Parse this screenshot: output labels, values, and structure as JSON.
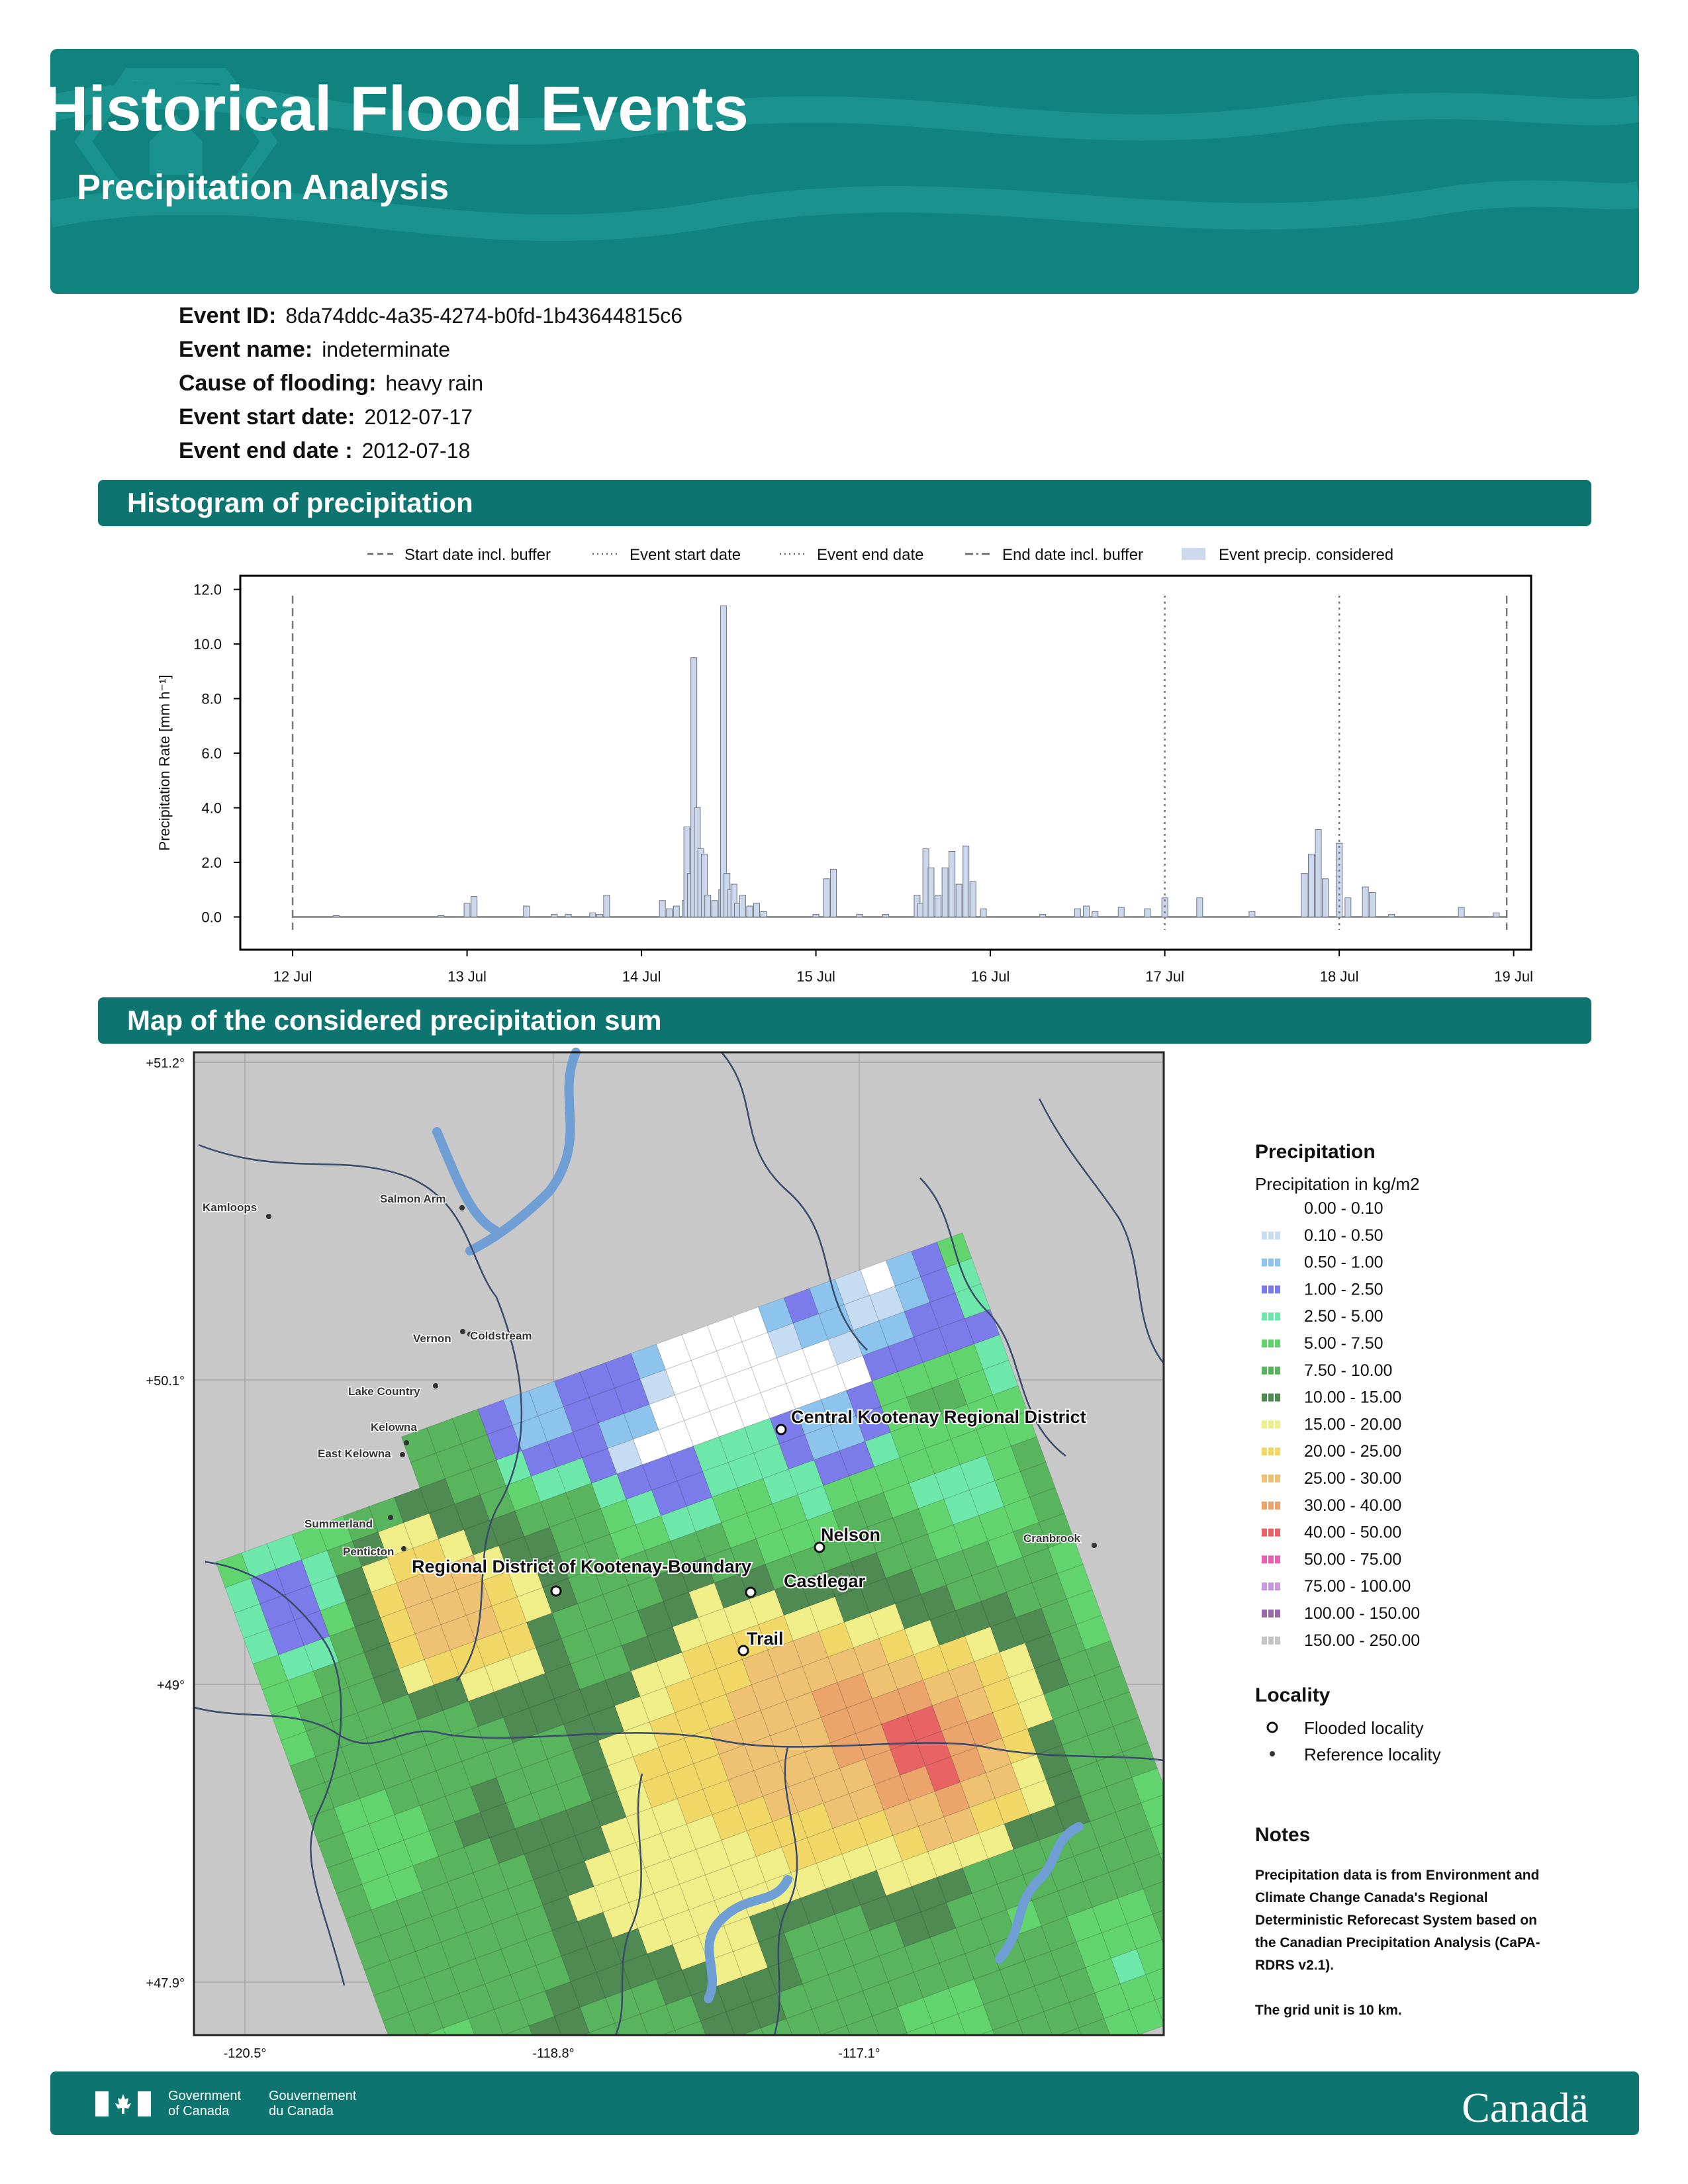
{
  "header": {
    "title": "Historical Flood Events",
    "subtitle": "Precipitation Analysis"
  },
  "event": {
    "fields": [
      {
        "label": "Event ID:",
        "value": "8da74ddc-4a35-4274-b0fd-1b43644815c6"
      },
      {
        "label": "Event name:",
        "value": "indeterminate"
      },
      {
        "label": "Cause of flooding:",
        "value": "heavy rain"
      },
      {
        "label": "Event start date:",
        "value": "2012-07-17"
      },
      {
        "label": "Event end date :",
        "value": "2012-07-18"
      }
    ]
  },
  "sections": {
    "histogram": "Histogram of precipitation",
    "map": "Map of the considered precipitation sum"
  },
  "chart_data": {
    "type": "bar",
    "ylabel": "Precipitation Rate [mm h⁻¹]",
    "ylim": [
      -1.2,
      12.5
    ],
    "yticks": [
      "0.0",
      "2.0",
      "4.0",
      "6.0",
      "8.0",
      "10.0",
      "12.0"
    ],
    "xlim": [
      11.7,
      19.1
    ],
    "xticks": [
      {
        "label": "12 Jul",
        "day": 12
      },
      {
        "label": "13 Jul",
        "day": 13
      },
      {
        "label": "14 Jul",
        "day": 14
      },
      {
        "label": "15 Jul",
        "day": 15
      },
      {
        "label": "16 Jul",
        "day": 16
      },
      {
        "label": "17 Jul",
        "day": 17
      },
      {
        "label": "18 Jul",
        "day": 18
      },
      {
        "label": "19 Jul",
        "day": 19
      }
    ],
    "legend": {
      "placement": "top",
      "entries": [
        {
          "label": "Start date incl. buffer",
          "style": "dashed"
        },
        {
          "label": "Event start date",
          "style": "dotted"
        },
        {
          "label": "Event end date",
          "style": "dotted"
        },
        {
          "label": "End date incl. buffer",
          "style": "dashdot"
        },
        {
          "label": "Event precip. considered",
          "style": "patch"
        }
      ]
    },
    "vlines": [
      {
        "day": 12.0,
        "style": "dashed"
      },
      {
        "day": 17.0,
        "style": "dotted"
      },
      {
        "day": 18.0,
        "style": "dotted"
      },
      {
        "day": 18.96,
        "style": "dashed"
      }
    ],
    "bars": [
      [
        12.25,
        0.05
      ],
      [
        12.85,
        0.05
      ],
      [
        13.0,
        0.5
      ],
      [
        13.04,
        0.75
      ],
      [
        13.34,
        0.4
      ],
      [
        13.5,
        0.1
      ],
      [
        13.58,
        0.1
      ],
      [
        13.72,
        0.15
      ],
      [
        13.76,
        0.1
      ],
      [
        13.8,
        0.8
      ],
      [
        14.12,
        0.6
      ],
      [
        14.16,
        0.3
      ],
      [
        14.2,
        0.4
      ],
      [
        14.25,
        0.6
      ],
      [
        14.26,
        3.3
      ],
      [
        14.28,
        1.6
      ],
      [
        14.3,
        9.5
      ],
      [
        14.32,
        4.0
      ],
      [
        14.34,
        2.5
      ],
      [
        14.36,
        2.3
      ],
      [
        14.38,
        0.8
      ],
      [
        14.42,
        0.6
      ],
      [
        14.46,
        1.0
      ],
      [
        14.47,
        11.4
      ],
      [
        14.49,
        1.6
      ],
      [
        14.51,
        1.0
      ],
      [
        14.53,
        1.2
      ],
      [
        14.55,
        0.5
      ],
      [
        14.58,
        0.8
      ],
      [
        14.62,
        0.4
      ],
      [
        14.66,
        0.5
      ],
      [
        14.7,
        0.2
      ],
      [
        15.0,
        0.1
      ],
      [
        15.06,
        1.4
      ],
      [
        15.1,
        1.75
      ],
      [
        15.25,
        0.1
      ],
      [
        15.4,
        0.1
      ],
      [
        15.58,
        0.8
      ],
      [
        15.6,
        0.5
      ],
      [
        15.63,
        2.5
      ],
      [
        15.66,
        1.8
      ],
      [
        15.7,
        0.8
      ],
      [
        15.74,
        1.8
      ],
      [
        15.78,
        2.4
      ],
      [
        15.82,
        1.2
      ],
      [
        15.86,
        2.6
      ],
      [
        15.9,
        1.3
      ],
      [
        15.96,
        0.3
      ],
      [
        16.3,
        0.1
      ],
      [
        16.5,
        0.3
      ],
      [
        16.55,
        0.4
      ],
      [
        16.6,
        0.2
      ],
      [
        16.75,
        0.35
      ],
      [
        16.9,
        0.3
      ],
      [
        17.0,
        0.7
      ],
      [
        17.2,
        0.7
      ],
      [
        17.5,
        0.2
      ],
      [
        17.8,
        1.6
      ],
      [
        17.84,
        2.3
      ],
      [
        17.88,
        3.2
      ],
      [
        17.92,
        1.4
      ],
      [
        18.0,
        2.7
      ],
      [
        18.05,
        0.7
      ],
      [
        18.15,
        1.1
      ],
      [
        18.19,
        0.9
      ],
      [
        18.3,
        0.1
      ],
      [
        18.7,
        0.35
      ],
      [
        18.9,
        0.15
      ]
    ]
  },
  "map": {
    "lat_labels": [
      "+51.2°",
      "+50.1°",
      "+49°",
      "+47.9°"
    ],
    "lon_labels": [
      "-120.5°",
      "-118.8°",
      "-117.1°"
    ],
    "colors": {
      "background": "#c8c8c8",
      "water": "#6e9ed4",
      "border": "#3a4a6a"
    },
    "flooded_localities": [
      {
        "name": "Central Kootenay Regional District"
      },
      {
        "name": "Nelson"
      },
      {
        "name": "Regional District of Kootenay-Boundary"
      },
      {
        "name": "Castlegar"
      },
      {
        "name": "Trail"
      }
    ],
    "reference_localities": [
      {
        "name": "Kamloops"
      },
      {
        "name": "Salmon Arm"
      },
      {
        "name": "Vernon"
      },
      {
        "name": "Coldstream"
      },
      {
        "name": "Lake Country"
      },
      {
        "name": "Kelowna"
      },
      {
        "name": "East Kelowna"
      },
      {
        "name": "Summerland"
      },
      {
        "name": "Penticton"
      },
      {
        "name": "Cranbrook"
      }
    ]
  },
  "legend": {
    "title": "Precipitation",
    "subtitle": "Precipitation in kg/m2",
    "bins": [
      {
        "label": "0.00 - 0.10",
        "color": "#ffffff"
      },
      {
        "label": "0.10 - 0.50",
        "color": "#c6dcf2"
      },
      {
        "label": "0.50 - 1.00",
        "color": "#8cc4ee"
      },
      {
        "label": "1.00 - 2.50",
        "color": "#7b7bea"
      },
      {
        "label": "2.50 - 5.00",
        "color": "#6ee8aa"
      },
      {
        "label": "5.00 - 7.50",
        "color": "#62d46e"
      },
      {
        "label": "7.50 - 10.00",
        "color": "#59b45e"
      },
      {
        "label": "10.00 - 15.00",
        "color": "#4f8a52"
      },
      {
        "label": "15.00 - 20.00",
        "color": "#f0ee88"
      },
      {
        "label": "20.00 - 25.00",
        "color": "#f0d766"
      },
      {
        "label": "25.00 - 30.00",
        "color": "#eec272"
      },
      {
        "label": "30.00 - 40.00",
        "color": "#eba46a"
      },
      {
        "label": "40.00 - 50.00",
        "color": "#e86464"
      },
      {
        "label": "50.00 - 75.00",
        "color": "#e860b4"
      },
      {
        "label": "75.00 - 100.00",
        "color": "#c898dc"
      },
      {
        "label": "100.00 - 150.00",
        "color": "#9a6aa8"
      },
      {
        "label": "150.00 - 250.00",
        "color": "#c4c4c4"
      }
    ],
    "locality_title": "Locality",
    "flooded_label": "Flooded locality",
    "reference_label": "Reference locality",
    "notes_title": "Notes",
    "notes_lines": [
      "Precipitation data is from Environment and",
      "Climate Change Canada's Regional",
      "Deterministic Reforecast System based on",
      "the Canadian Precipitation Analysis (CaPA-",
      "RDRS v2.1).",
      "",
      "The grid unit is 10 km."
    ]
  },
  "footer": {
    "gov_en": "Government\nof Canada",
    "gov_fr": "Gouvernement\ndu Canada",
    "wordmark": "Canadä"
  }
}
